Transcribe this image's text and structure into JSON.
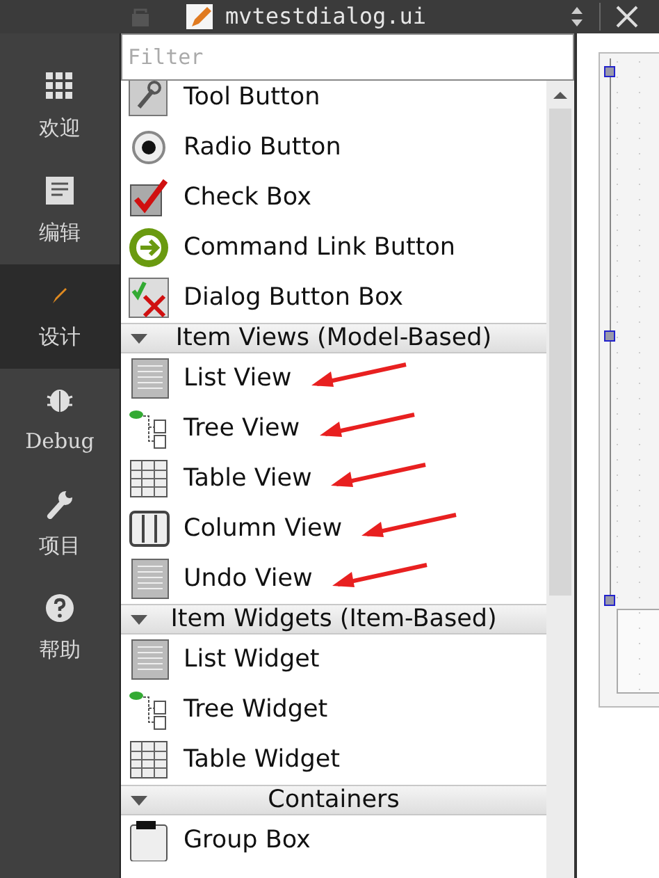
{
  "editor_tab": {
    "title": "mvtestdialog.ui"
  },
  "mode_bar": [
    {
      "label": "欢迎",
      "kind": "welcome",
      "selected": false
    },
    {
      "label": "编辑",
      "kind": "edit",
      "selected": false
    },
    {
      "label": "设计",
      "kind": "design",
      "selected": true
    },
    {
      "label": "Debug",
      "kind": "debug",
      "selected": false
    },
    {
      "label": "项目",
      "kind": "projects",
      "selected": false
    },
    {
      "label": "帮助",
      "kind": "help",
      "selected": false
    }
  ],
  "filter": {
    "placeholder": "Filter"
  },
  "widget_box": [
    {
      "items": [
        {
          "label": "Tool Button",
          "kind": "tool",
          "annotated": false
        },
        {
          "label": "Radio Button",
          "kind": "radio",
          "annotated": false
        },
        {
          "label": "Check Box",
          "kind": "check",
          "annotated": false
        },
        {
          "label": "Command Link Button",
          "kind": "command",
          "annotated": false
        },
        {
          "label": "Dialog Button Box",
          "kind": "dialog",
          "annotated": false
        }
      ]
    },
    {
      "title": "Item Views (Model-Based)",
      "expanded": true,
      "items": [
        {
          "label": "List View",
          "kind": "list",
          "annotated": true
        },
        {
          "label": "Tree View",
          "kind": "tree",
          "annotated": true
        },
        {
          "label": "Table View",
          "kind": "table",
          "annotated": true
        },
        {
          "label": "Column View",
          "kind": "column",
          "annotated": true
        },
        {
          "label": "Undo View",
          "kind": "list",
          "annotated": true
        }
      ]
    },
    {
      "title": "Item Widgets (Item-Based)",
      "expanded": true,
      "items": [
        {
          "label": "List Widget",
          "kind": "list",
          "annotated": false
        },
        {
          "label": "Tree Widget",
          "kind": "tree",
          "annotated": false
        },
        {
          "label": "Table Widget",
          "kind": "table",
          "annotated": false
        }
      ]
    },
    {
      "title": "Containers",
      "expanded": true,
      "items": [
        {
          "label": "Group Box",
          "kind": "group",
          "annotated": false
        }
      ]
    }
  ]
}
